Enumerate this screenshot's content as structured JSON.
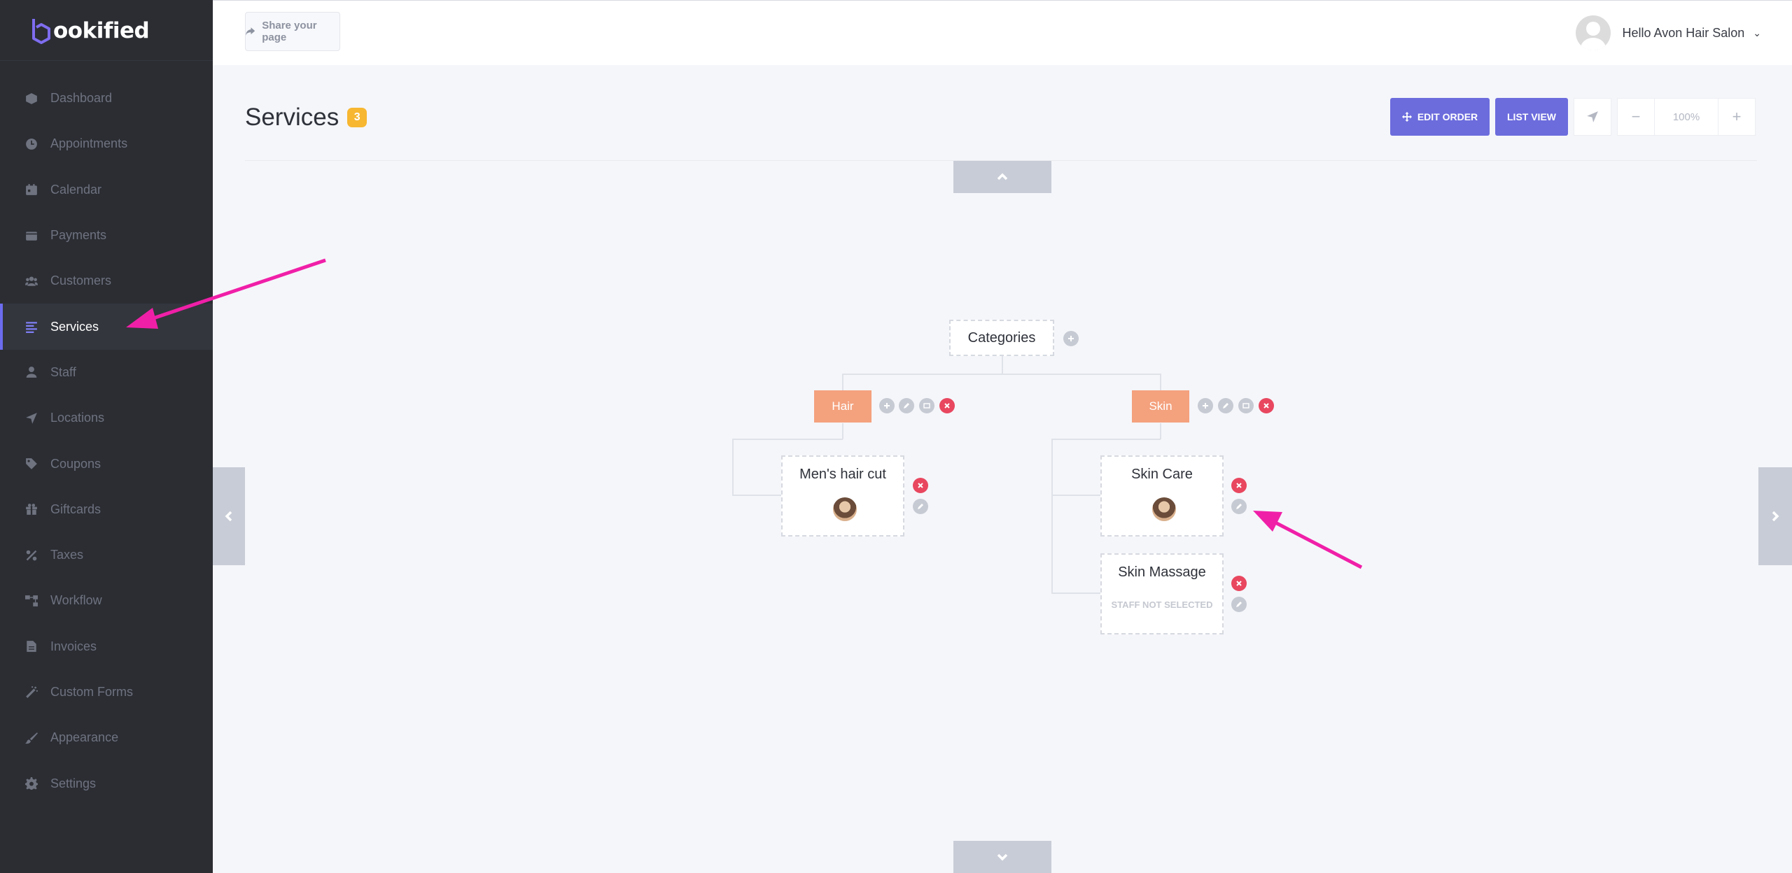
{
  "brand": {
    "logo_text": "ookified",
    "logo_letter": "b"
  },
  "sidebar": {
    "items": [
      {
        "label": "Dashboard",
        "icon": "dashboard-icon"
      },
      {
        "label": "Appointments",
        "icon": "clock-icon"
      },
      {
        "label": "Calendar",
        "icon": "calendar-icon"
      },
      {
        "label": "Payments",
        "icon": "wallet-icon"
      },
      {
        "label": "Customers",
        "icon": "users-icon"
      },
      {
        "label": "Services",
        "icon": "list-icon",
        "active": true
      },
      {
        "label": "Staff",
        "icon": "user-icon"
      },
      {
        "label": "Locations",
        "icon": "location-arrow-icon"
      },
      {
        "label": "Coupons",
        "icon": "tag-icon"
      },
      {
        "label": "Giftcards",
        "icon": "gift-icon"
      },
      {
        "label": "Taxes",
        "icon": "percent-icon"
      },
      {
        "label": "Workflow",
        "icon": "workflow-icon"
      },
      {
        "label": "Invoices",
        "icon": "file-icon"
      },
      {
        "label": "Custom Forms",
        "icon": "magic-icon"
      },
      {
        "label": "Appearance",
        "icon": "brush-icon"
      },
      {
        "label": "Settings",
        "icon": "gear-icon"
      }
    ]
  },
  "header": {
    "share_label": "Share your page",
    "greeting": "Hello Avon Hair Salon"
  },
  "page": {
    "title": "Services",
    "count": "3",
    "edit_order_label": "EDIT ORDER",
    "list_view_label": "LIST VIEW",
    "zoom_value": "100%"
  },
  "tree": {
    "root_label": "Categories",
    "categories": [
      {
        "label": "Hair",
        "services": [
          {
            "name": "Men's hair cut",
            "staff_assigned": true
          }
        ]
      },
      {
        "label": "Skin",
        "services": [
          {
            "name": "Skin Care",
            "staff_assigned": true
          },
          {
            "name": "Skin Massage",
            "staff_assigned": false,
            "staff_note": "STAFF NOT SELECTED"
          }
        ]
      }
    ]
  },
  "colors": {
    "sidebar_bg": "#2b2d33",
    "accent": "#6c6cdd",
    "category_bg": "#f4a17d",
    "delete_red": "#e8475f",
    "badge_yellow": "#f7b731",
    "annotation_arrow": "#f01fa8"
  }
}
